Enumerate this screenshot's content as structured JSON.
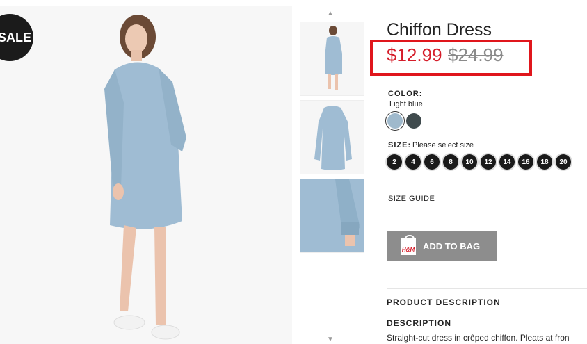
{
  "badge": {
    "sale": "SALE"
  },
  "product": {
    "title": "Chiffon Dress",
    "price_sale": "$12.99",
    "price_original": "$24.99",
    "highlight_color": "#e0161c",
    "sale_price_color": "#d51d2a"
  },
  "color": {
    "label": "COLOR:",
    "selected": "Light blue",
    "swatches": [
      {
        "name": "Light blue",
        "hex": "#9fb9cc",
        "selected": true
      },
      {
        "name": "Dark gray",
        "hex": "#3f4a4d",
        "selected": false
      }
    ]
  },
  "size": {
    "label": "SIZE:",
    "hint": "Please select size",
    "options": [
      "2",
      "4",
      "6",
      "8",
      "10",
      "12",
      "14",
      "16",
      "18",
      "20"
    ]
  },
  "size_guide": "SIZE GUIDE",
  "add_to_bag": {
    "label": "ADD TO BAG",
    "icon": "shopping-bag-icon",
    "bag_text": "H&M"
  },
  "product_description_heading": "PRODUCT DESCRIPTION",
  "description": {
    "heading": "DESCRIPTION",
    "text": "Straight-cut dress in crêped chiffon. Pleats at fron"
  },
  "thumbnails": [
    "model-front",
    "dress-flat",
    "sleeve-detail"
  ]
}
